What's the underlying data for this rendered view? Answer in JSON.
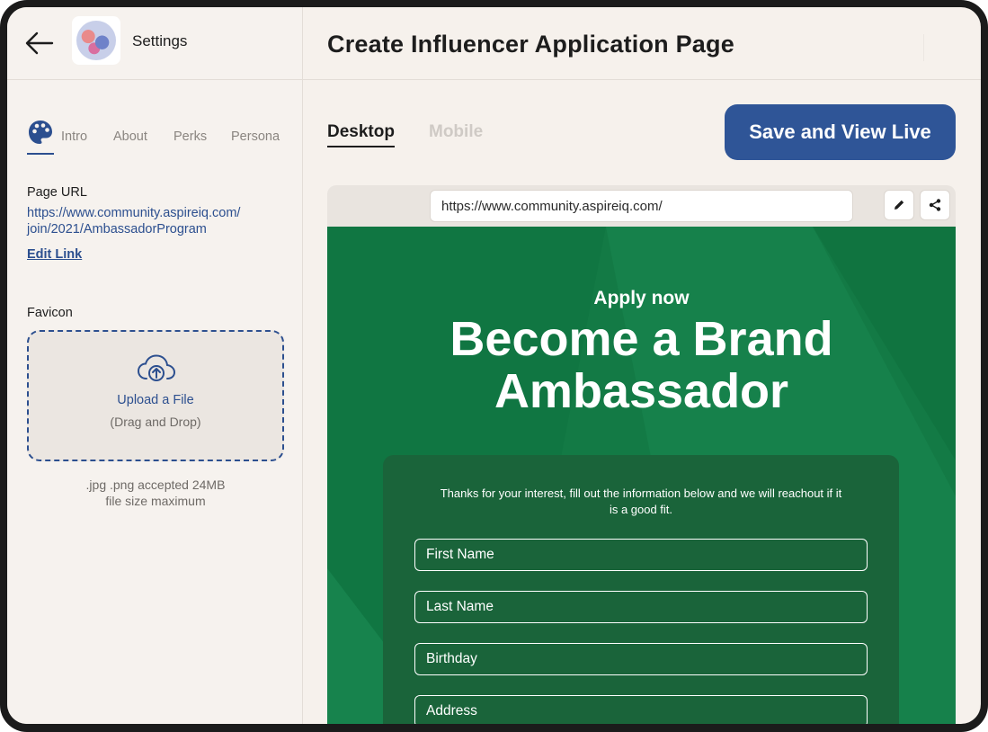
{
  "sidebar": {
    "title": "Settings",
    "tabs": [
      "Intro",
      "About",
      "Perks",
      "Persona"
    ],
    "page_url": {
      "label": "Page URL",
      "line1": "https://www.community.aspireiq.com/",
      "line2": "join/2021/AmbassadorProgram",
      "edit_label": "Edit Link"
    },
    "favicon": {
      "label": "Favicon",
      "upload_title": "Upload a File",
      "upload_sub": "(Drag and Drop)",
      "note_line1": ".jpg .png accepted 24MB",
      "note_line2": "file size maximum"
    }
  },
  "main": {
    "title": "Create Influencer Application Page",
    "view_tabs": [
      "Desktop",
      "Mobile"
    ],
    "active_view": "Desktop",
    "save_label": "Save and View Live"
  },
  "preview": {
    "url": "https://www.community.aspireiq.com/",
    "apply_label": "Apply now",
    "hero_line1": "Become a Brand",
    "hero_line2": "Ambassador",
    "form_intro": "Thanks for your interest, fill out the information below and we will reachout if it is a good fit.",
    "fields": [
      "First Name",
      "Last Name",
      "Birthday",
      "Address"
    ]
  },
  "colors": {
    "accent": "#2f5597",
    "link": "#2c4f8f",
    "canvas_green": "#137a45",
    "card_green": "#1a643a"
  },
  "icons": [
    "back-arrow-icon",
    "palette-icon",
    "cloud-upload-icon",
    "pencil-icon",
    "share-icon"
  ]
}
